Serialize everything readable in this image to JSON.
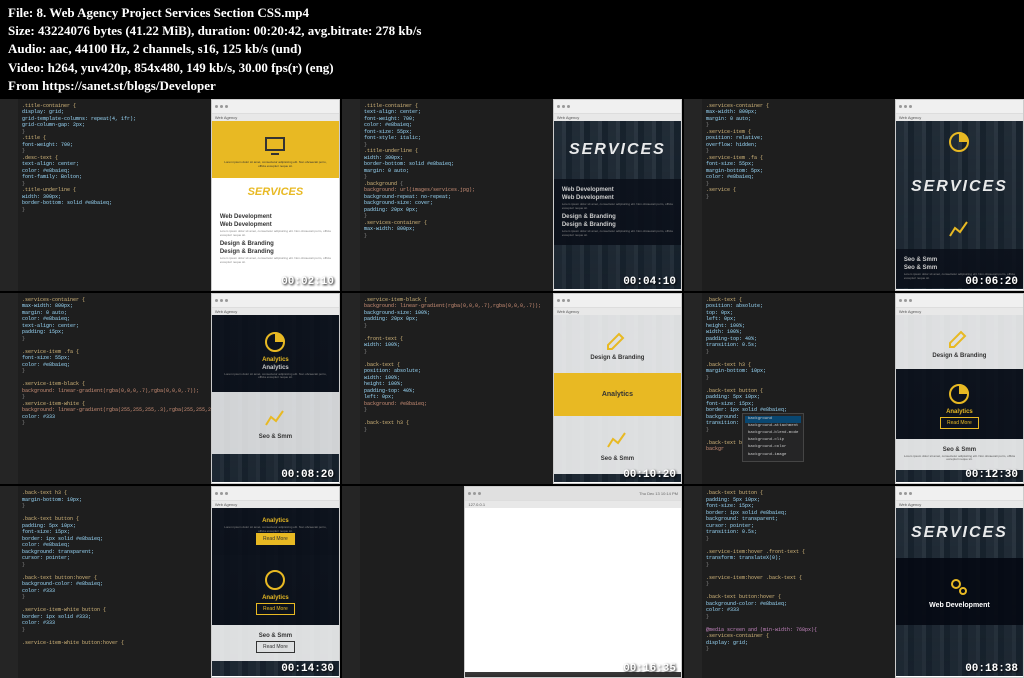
{
  "header": {
    "file_label": "File:",
    "file_value": "8. Web Agency Project Services Section CSS.mp4",
    "size_label": "Size:",
    "size_value": "43224076 bytes (41.22 MiB),",
    "duration_label": "duration:",
    "duration_value": "00:20:42,",
    "bitrate_label": "avg.bitrate:",
    "bitrate_value": "278 kb/s",
    "audio_label": "Audio:",
    "audio_value": "aac, 44100 Hz, 2 channels, s16, 125 kb/s (und)",
    "video_label": "Video:",
    "video_value": "h264, yuv420p, 854x480, 149 kb/s, 30.00 fps(r) (eng)",
    "from_label": "From",
    "from_value": "https://sanet.st/blogs/Developer"
  },
  "timestamps": [
    "00:02:10",
    "00:04:10",
    "00:06:20",
    "00:08:20",
    "00:10:20",
    "00:12:30",
    "00:14:30",
    "00:16:35",
    "00:18:38"
  ],
  "browser": {
    "tab": "Web Agency",
    "url": "127.0.0.1"
  },
  "preview": {
    "services_title": "SERVICES",
    "web_dev": "Web Development",
    "design_branding": "Design & Branding",
    "analytics": "Analytics",
    "seo_smm": "Seo & Smm",
    "read_more": "Read More",
    "lorem": "Lorem ipsum dolor sit amet, consectetur adipisicing elit. Non obcaecati porro, officia excepturi neque sit."
  },
  "code": {
    "selectors": [
      ".title-container {",
      ".title {",
      ".desc-text {",
      ".title-underline {",
      ".services-container {",
      ".service-item {",
      ".front-text {",
      ".back-text {",
      ".service-item-black {",
      ".service-item-white {",
      ".back-text h3 {",
      ".back-text button {",
      ".back-text button:hover {",
      ".service-item:hover .front-text {",
      ".service-item:hover .back-text {",
      ".service-item-white button {",
      ".service-item-white button:hover {"
    ],
    "props": [
      "display: grid;",
      "grid-template-columns: repeat(4, 1fr);",
      "grid-column-gap: 2px;",
      "text-align: center;",
      "font-weight: 700;",
      "color: #e8ba1eq;",
      "font-size: 55px;",
      "font-style: italic;",
      "width: 300px;",
      "border-bottom: solid #e8ba1eq;",
      "margin: 0 auto;",
      "max-width: 800px;",
      "font-family: Bolton;",
      "background-repeat: no-repeat;",
      "background-size: cover;",
      "padding: 20px 0px;",
      "transition: 0.5s;",
      "position: absolute;",
      "height: 100%;",
      "padding-top: 40%;",
      "font-size: 15px;",
      "border: 1px solid #e8ba1eq;",
      "background: transparent;",
      "transform: translateX(0);",
      "cursor: pointer;",
      "background-color: #e8ba1eq;",
      "color: #333"
    ],
    "bg_img": "background: url(images/services.jpg);",
    "gradient": "background: linear-gradient(rgba(0,0,0,.7),rgba(0,0,0,.7));",
    "media": "@media screen and (min-width: 768px){"
  },
  "autocomplete": {
    "items": [
      "background",
      "background-attachment",
      "background-blend-mode",
      "background-clip",
      "background-color",
      "background-image"
    ]
  }
}
